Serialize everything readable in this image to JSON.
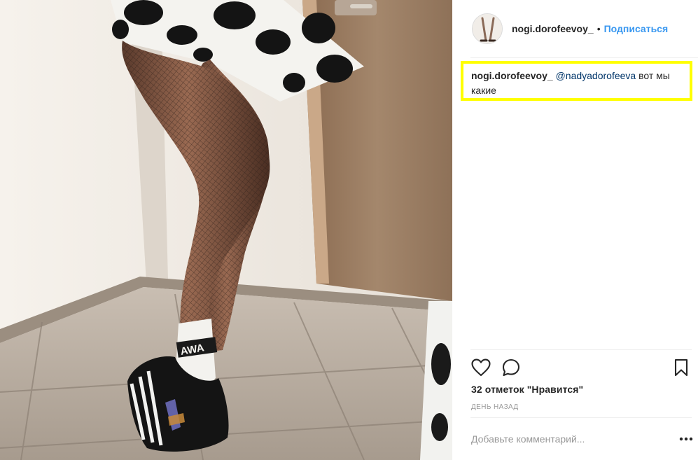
{
  "post": {
    "username": "nogi.dorofeevoy_",
    "separator": "•",
    "follow_label": "Подписаться"
  },
  "caption": {
    "author": "nogi.dorofeevoy_",
    "mention": "@nadyadorofeeva",
    "text": " вот мы какие"
  },
  "actions": {
    "like_icon": "heart-outline-icon",
    "comment_icon": "speech-bubble-icon",
    "save_icon": "bookmark-icon"
  },
  "likes_text": "32 отметок \"Нравится\"",
  "timestamp": "ДЕНЬ НАЗАД",
  "comment": {
    "placeholder": "Добавьте комментарий...",
    "more_icon": "ellipsis-icon"
  },
  "colors": {
    "highlight_border": "#ffff00",
    "link_blue": "#3897f0",
    "mention_blue": "#003569",
    "text": "#262626",
    "muted": "#999999"
  }
}
